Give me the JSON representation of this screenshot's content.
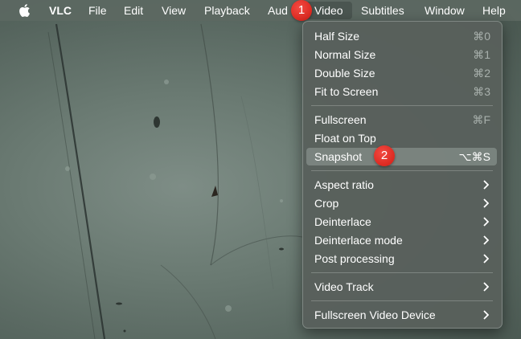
{
  "menubar": {
    "app": "VLC",
    "items": [
      "File",
      "Edit",
      "View",
      "Playback",
      "Aud",
      "Video",
      "Subtitles",
      "Window",
      "Help"
    ]
  },
  "video_menu": {
    "items": [
      {
        "label": "Half Size",
        "shortcut": "⌘0"
      },
      {
        "label": "Normal Size",
        "shortcut": "⌘1"
      },
      {
        "label": "Double Size",
        "shortcut": "⌘2"
      },
      {
        "label": "Fit to Screen",
        "shortcut": "⌘3"
      },
      {
        "label": "Fullscreen",
        "shortcut": "⌘F"
      },
      {
        "label": "Float on Top",
        "shortcut": ""
      },
      {
        "label": "Snapshot",
        "shortcut": "⌥⌘S",
        "highlighted": true
      },
      {
        "label": "Aspect ratio",
        "submenu": true
      },
      {
        "label": "Crop",
        "submenu": true
      },
      {
        "label": "Deinterlace",
        "submenu": true
      },
      {
        "label": "Deinterlace mode",
        "submenu": true
      },
      {
        "label": "Post processing",
        "submenu": true
      },
      {
        "label": "Video Track",
        "submenu": true
      },
      {
        "label": "Fullscreen Video Device",
        "submenu": true
      }
    ]
  },
  "badges": [
    "1",
    "2"
  ],
  "colors": {
    "badge": "#e0251c",
    "highlight": "#96a09b"
  }
}
